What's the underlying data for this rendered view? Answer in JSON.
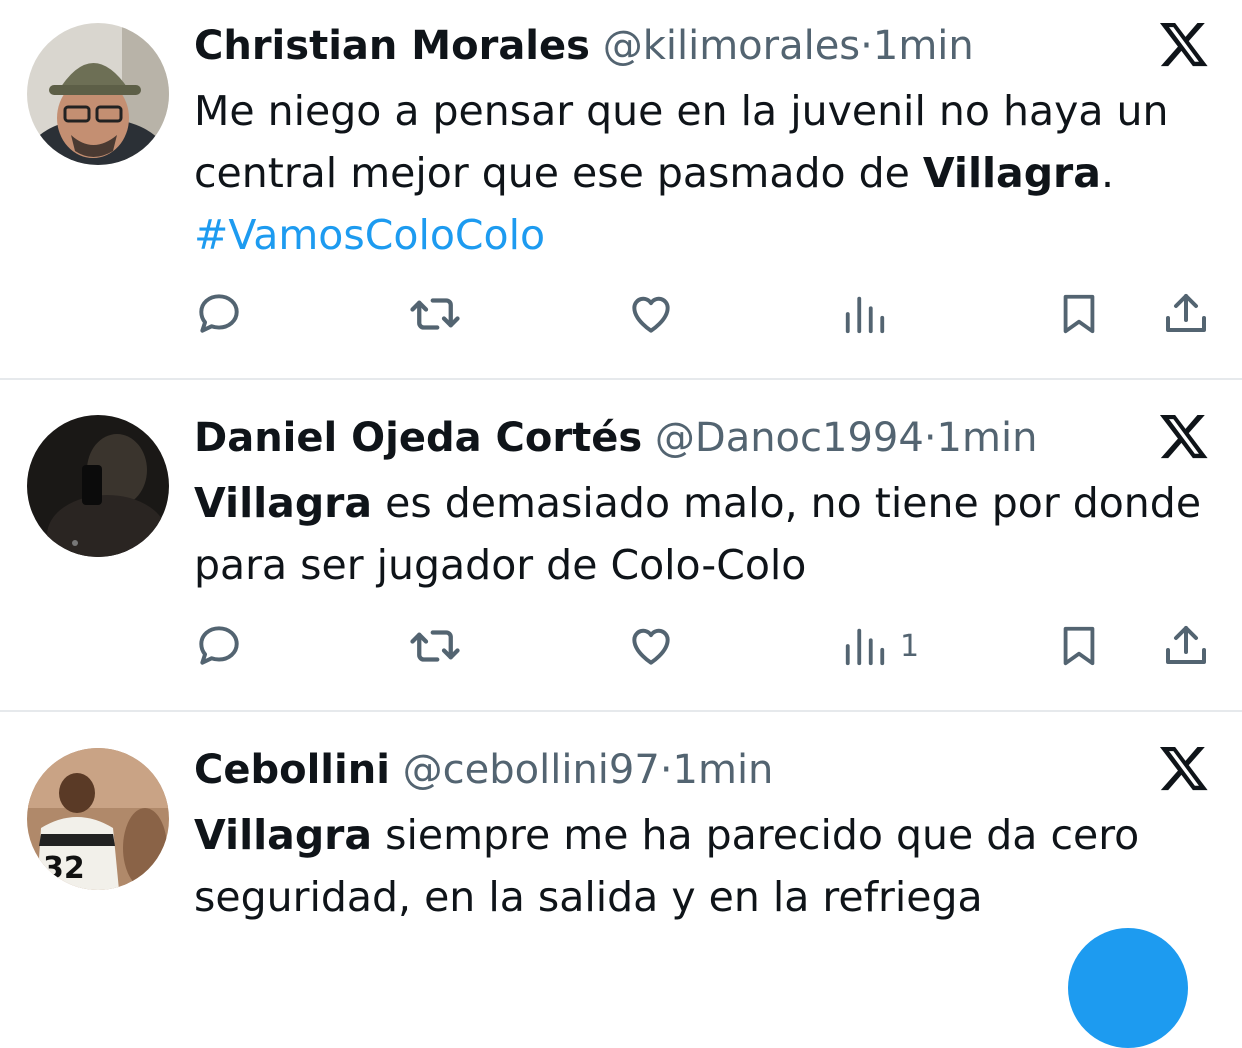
{
  "tweets": [
    {
      "name": "Christian Morales",
      "handle": "@kilimorales",
      "separator": "·",
      "time": "1min",
      "text_before": "Me niego a pensar que en la juvenil no haya un central mejor que ese pasmado de ",
      "bold": "Villagra",
      "text_after": ".",
      "hashtag": "#VamosColoColo",
      "views_count": ""
    },
    {
      "name": "Daniel Ojeda Cortés",
      "handle": "@Danoc1994",
      "separator": "·",
      "time": "1min",
      "bold": "Villagra",
      "text_after": " es demasiado malo, no tiene por donde para ser jugador de Colo-Colo",
      "views_count": "1"
    },
    {
      "name": "Cebollini",
      "handle": "@cebollini97",
      "separator": "·",
      "time": "1min",
      "bold": "Villagra",
      "text_after": " siempre me ha parecido que da cero seguridad, en la salida y en la refriega"
    }
  ],
  "icons": {
    "reply": "comment-icon",
    "retweet": "retweet-icon",
    "like": "heart-icon",
    "views": "views-icon",
    "bookmark": "bookmark-icon",
    "share": "share-icon",
    "brand": "x-logo-icon"
  },
  "colors": {
    "text": "#0f1419",
    "secondary": "#536471",
    "link": "#1d9bf0",
    "divider": "#e6e9ec"
  }
}
